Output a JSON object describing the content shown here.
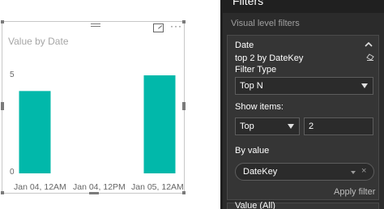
{
  "visual": {
    "title": "Value by Date",
    "menu_glyph": "···",
    "y_ticks": [
      "5",
      "0"
    ],
    "x_ticks": [
      "Jan 04, 12AM",
      "Jan 04, 12PM",
      "Jan 05, 12AM"
    ]
  },
  "chart_data": {
    "type": "bar",
    "title": "Value by Date",
    "x": [
      "Jan 04, 12AM",
      "Jan 05, 12AM"
    ],
    "values": [
      4.2,
      5.0
    ],
    "x_tick_labels": [
      "Jan 04, 12AM",
      "Jan 04, 12PM",
      "Jan 05, 12AM"
    ],
    "y_ticks": [
      0,
      5
    ],
    "ylim": [
      0,
      5
    ],
    "grid": false,
    "bar_color": "#01b8aa"
  },
  "filters_pane": {
    "title": "Filters",
    "section_label": "Visual level filters",
    "filter_card": {
      "field": "Date",
      "summary": "top 2 by DateKey",
      "filter_type_label": "Filter Type",
      "filter_type_value": "Top N",
      "show_items_label": "Show items:",
      "show_direction": "Top",
      "show_count": "2",
      "by_value_label": "By value",
      "by_value_field": "DateKey",
      "remove_glyph": "×",
      "apply_label": "Apply filter"
    },
    "next_card_label": "Value (All)"
  },
  "colors": {
    "bar": "#01b8aa",
    "pane_background": "#2b2b2b",
    "card_background": "#353535"
  },
  "icons": [
    "focus-mode-icon",
    "more-options-icon",
    "collapse-icon",
    "eraser-icon",
    "dropdown-arrow-icon",
    "remove-field-icon"
  ]
}
